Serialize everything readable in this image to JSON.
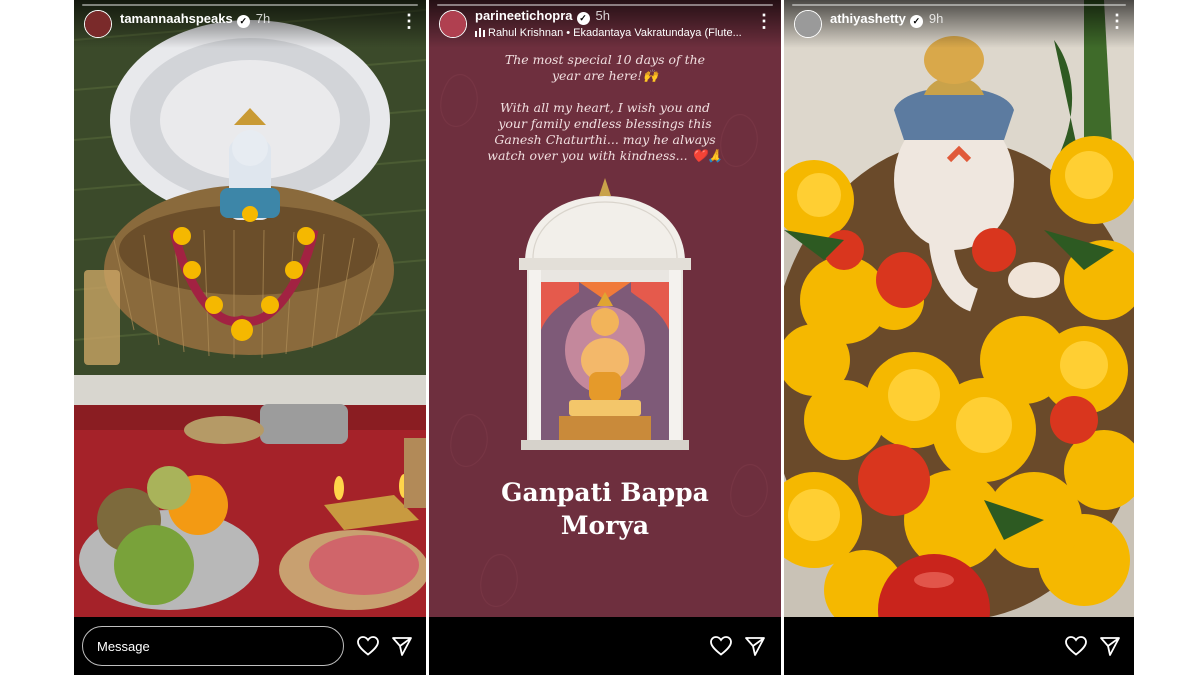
{
  "stories": [
    {
      "username": "tamannaahspeaks",
      "verified_mark": "✓",
      "time": "7h",
      "avatar_color": "#7a2a2a",
      "message_placeholder": "Message"
    },
    {
      "username": "parineetichopra",
      "verified_mark": "✓",
      "time": "5h",
      "avatar_color": "#b04050",
      "music": "Rahul Krishnan • Ekadantaya Vakratundaya (Flute...",
      "wish_lines": [
        "The most special 10 days of the",
        "year are here!🙌",
        "",
        "With all my heart, I wish you and",
        "your family endless blessings this",
        "Ganesh Chaturthi... may he always",
        "watch over you with kindness... ❤️🙏"
      ],
      "greeting_line1": "Ganpati Bappa",
      "greeting_line2": "Morya"
    },
    {
      "username": "athiyashetty",
      "verified_mark": "✓",
      "time": "9h",
      "avatar_color": "#9a9a9a"
    }
  ],
  "icons": {
    "more": "more-vertical-icon",
    "like": "heart-icon",
    "share": "send-icon",
    "music": "music-bars-icon"
  },
  "colors": {
    "story_card_bg": "#6e2f3e",
    "marigold": "#f5b800",
    "bar_bg": "#000000"
  }
}
